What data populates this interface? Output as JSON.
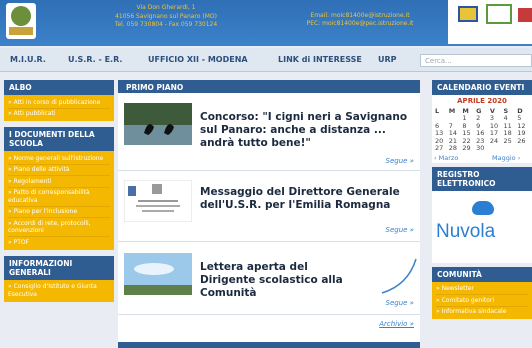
{
  "header": {
    "address_line1": "Via Don Gherardi, 1",
    "address_line2": "41056 Savignano sul Panaro (MO)",
    "phone_line": "Tel. 059 730804 - Fax 059 730124",
    "email_line": "Email: moic81400e@istruzione.it",
    "pec_line": "PEC: moic81400e@pec.istruzione.it"
  },
  "nav": {
    "items": [
      "M.I.U.R.",
      "U.S.R. - E.R.",
      "UFFICIO XII - MODENA",
      "LINK di INTERESSE",
      "URP"
    ],
    "search_placeholder": "Cerca..."
  },
  "left": {
    "albo": {
      "title": "ALBO",
      "items": [
        "» Atti in corso di pubblicazione",
        "» Atti pubblicati"
      ]
    },
    "documenti": {
      "title": "I DOCUMENTI DELLA SCUOLA",
      "items": [
        "» Norme generali sull'istruzione",
        "» Piano delle attività",
        "» Regolamenti",
        "» Patto di corresponsabilità educativa",
        "» Piano per l'inclusione",
        "» Accordi di rete, protocolli, convenzioni",
        "» PTOF"
      ]
    },
    "informazioni": {
      "title": "INFORMAZIONI GENERALI",
      "items": [
        "» Consiglio d'Istituto e Giunta Esecutiva"
      ]
    }
  },
  "center": {
    "title": "PRIMO PIANO",
    "news": [
      {
        "title": "Concorso: \"I cigni neri a Savignano sul Panaro: anche a distanza ... andrà tutto bene!\"",
        "more": "Segue »"
      },
      {
        "title": "Messaggio del Direttore Generale dell'U.S.R. per l'Emilia Romagna",
        "more": "Segue »"
      },
      {
        "title": "Lettera aperta del Dirigente scolastico alla Comunità",
        "more": "Segue »"
      }
    ],
    "archive": "Archivio »"
  },
  "right": {
    "calendar": {
      "title": "CALENDARIO EVENTI",
      "month": "APRILE 2020",
      "days": [
        "L",
        "M",
        "M",
        "G",
        "V",
        "S",
        "D"
      ],
      "weeks": [
        [
          "",
          "",
          "1",
          "2",
          "3",
          "4",
          "5"
        ],
        [
          "6",
          "7",
          "8",
          "9",
          "10",
          "11",
          "12"
        ],
        [
          "13",
          "14",
          "15",
          "16",
          "17",
          "18",
          "19"
        ],
        [
          "20",
          "21",
          "22",
          "23",
          "24",
          "25",
          "26"
        ],
        [
          "27",
          "28",
          "29",
          "30",
          "",
          "",
          ""
        ]
      ],
      "prev": "‹ Marzo",
      "next": "Maggio ›"
    },
    "registro": {
      "title": "REGISTRO ELETTRONICO",
      "brand": "Nuvola"
    },
    "comunita": {
      "title": "COMUNITÀ",
      "items": [
        "» Newsletter",
        "» Comitato genitori",
        "» Informativa sindacale"
      ]
    }
  },
  "colors": {
    "header_blue": "#3c82c9",
    "panel_blue": "#2f5d91",
    "accent_yellow": "#f5b800",
    "link_blue": "#3c82c9"
  }
}
